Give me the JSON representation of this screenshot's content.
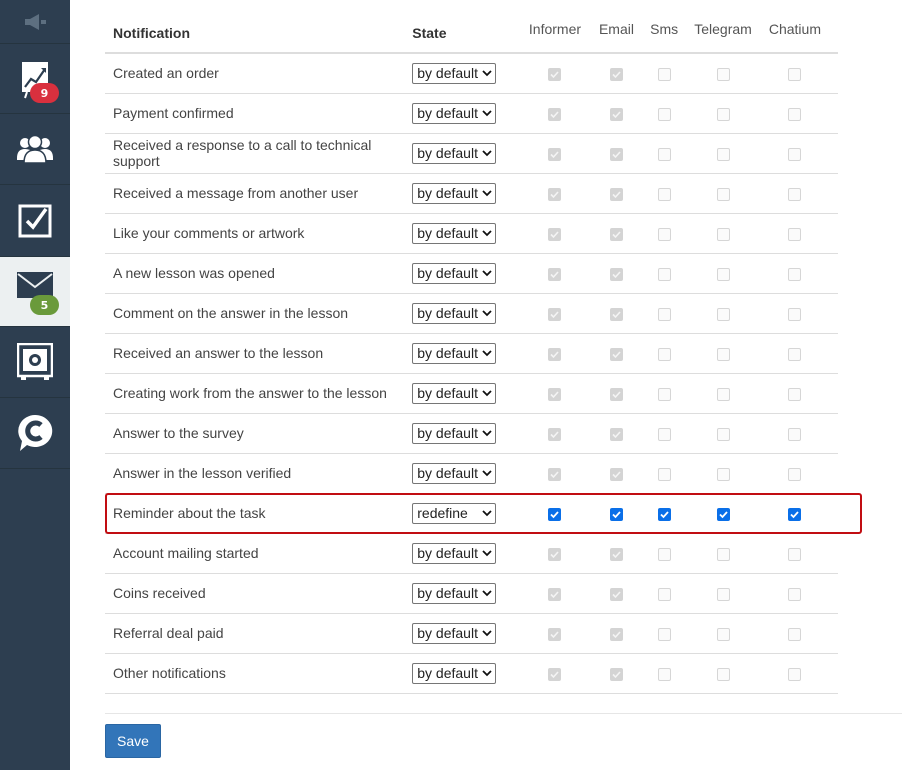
{
  "sidebar": {
    "items": [
      {
        "icon": "megaphone-icon"
      },
      {
        "icon": "chart-icon",
        "badge": "9"
      },
      {
        "icon": "users-icon"
      },
      {
        "icon": "checkbox-icon"
      },
      {
        "icon": "mail-icon",
        "badge": "5",
        "active": true
      },
      {
        "icon": "safe-icon"
      },
      {
        "icon": "chatium-logo-icon"
      }
    ]
  },
  "table": {
    "headers": {
      "notification": "Notification",
      "state": "State",
      "informer": "Informer",
      "email": "Email",
      "sms": "Sms",
      "telegram": "Telegram",
      "chatium": "Chatium"
    },
    "rows": [
      {
        "name": "Created an order",
        "state": "by default"
      },
      {
        "name": "Payment confirmed",
        "state": "by default"
      },
      {
        "name": "Received a response to a call to technical support",
        "state": "by default"
      },
      {
        "name": "Received a message from another user",
        "state": "by default"
      },
      {
        "name": "Like your comments or artwork",
        "state": "by default"
      },
      {
        "name": "A new lesson was opened",
        "state": "by default"
      },
      {
        "name": "Comment on the answer in the lesson",
        "state": "by default"
      },
      {
        "name": "Received an answer to the lesson",
        "state": "by default"
      },
      {
        "name": "Creating work from the answer to the lesson",
        "state": "by default"
      },
      {
        "name": "Answer to the survey",
        "state": "by default"
      },
      {
        "name": "Answer in the lesson verified",
        "state": "by default"
      },
      {
        "name": "Reminder about the task",
        "state": "redefine"
      },
      {
        "name": "Account mailing started",
        "state": "by default"
      },
      {
        "name": "Coins received",
        "state": "by default"
      },
      {
        "name": "Referral deal paid",
        "state": "by default"
      },
      {
        "name": "Other notifications",
        "state": "by default"
      }
    ]
  },
  "save_label": "Save",
  "colors": {
    "sidebar_bg": "#2d3e50",
    "highlight": "#c10d12",
    "primary": "#3275b9",
    "checkbox_on": "#0a6fe8"
  }
}
